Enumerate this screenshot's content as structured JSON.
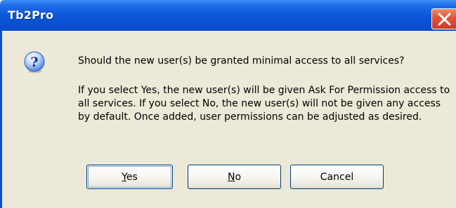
{
  "window": {
    "title": "Tb2Pro",
    "close_icon": "close-icon"
  },
  "message": {
    "icon": "question-icon",
    "question": "Should the new user(s) be granted minimal access to all services?",
    "details": "If you select Yes, the new user(s) will be given Ask For Permission access to all services. If you select No, the new user(s) will not be given any access by default. Once added, user permissions can be adjusted as desired."
  },
  "buttons": {
    "yes": {
      "mnemonic": "Y",
      "rest": "es"
    },
    "no": {
      "mnemonic": "N",
      "rest": "o"
    },
    "cancel": "Cancel"
  },
  "colors": {
    "titlebar": "#0a4fd1",
    "dialog_background": "#ece9d8",
    "close_button": "#e0573a"
  }
}
